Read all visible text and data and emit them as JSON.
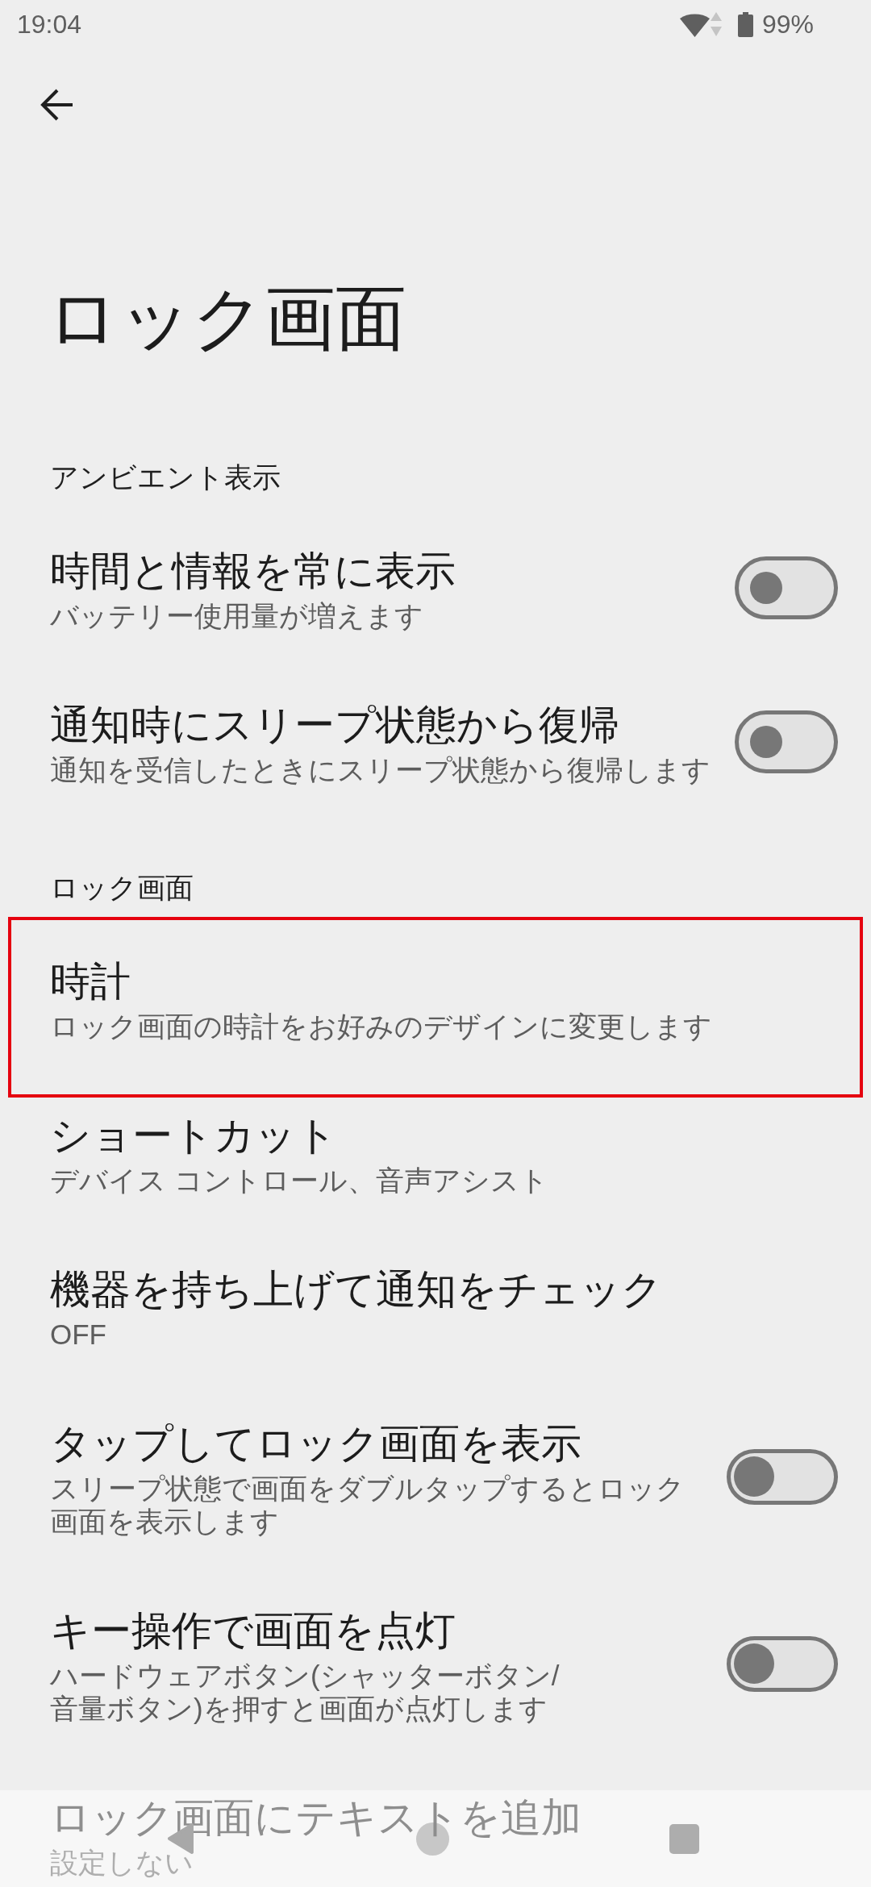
{
  "status_bar": {
    "time": "19:04",
    "battery": "99%"
  },
  "title": "ロック画面",
  "sections": [
    {
      "header": "アンビエント表示",
      "items": [
        {
          "kind": "switch",
          "title": "時間と情報を常に表示",
          "summary": "バッテリー使用量が増えます",
          "on": false,
          "highlighted": false
        },
        {
          "kind": "switch",
          "title": "通知時にスリープ状態から復帰",
          "summary": "通知を受信したときにスリープ状態から復帰します",
          "on": false,
          "highlighted": false
        }
      ]
    },
    {
      "header": "ロック画面",
      "items": [
        {
          "kind": "plain",
          "title": "時計",
          "summary": "ロック画面の時計をお好みのデザインに変更します",
          "highlighted": true
        },
        {
          "kind": "plain",
          "title": "ショートカット",
          "summary": "デバイス コントロール、音声アシスト",
          "highlighted": false
        },
        {
          "kind": "plain",
          "title": "機器を持ち上げて通知をチェック",
          "summary": "OFF",
          "highlighted": false
        },
        {
          "kind": "toggle",
          "title": "タップしてロック画面を表示",
          "summary": "スリープ状態で画面をダブルタップするとロック画面を表示します",
          "on": false,
          "highlighted": false
        },
        {
          "kind": "toggle",
          "title": "キー操作で画面を点灯",
          "summary": "ハードウェアボタン(シャッターボタン/\n音量ボタン)を押すと画面が点灯します",
          "on": false,
          "highlighted": false
        },
        {
          "kind": "plain",
          "title": "ロック画面にテキストを追加",
          "summary": "設定しない",
          "highlighted": false
        }
      ]
    }
  ]
}
